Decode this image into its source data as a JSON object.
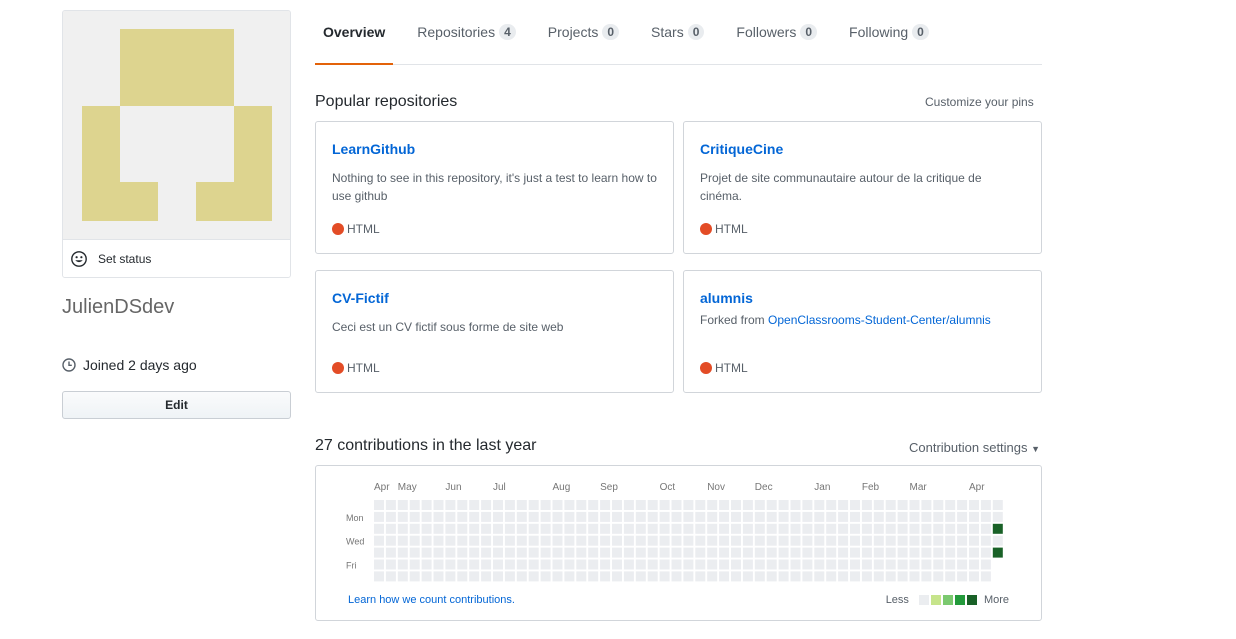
{
  "profile": {
    "username": "JulienDSdev",
    "set_status_label": "Set status",
    "joined": "Joined 2 days ago",
    "edit_label": "Edit",
    "avatar_color": "#ddd48f"
  },
  "tabs": [
    {
      "label": "Overview",
      "count": null,
      "active": true
    },
    {
      "label": "Repositories",
      "count": "4",
      "active": false
    },
    {
      "label": "Projects",
      "count": "0",
      "active": false
    },
    {
      "label": "Stars",
      "count": "0",
      "active": false
    },
    {
      "label": "Followers",
      "count": "0",
      "active": false
    },
    {
      "label": "Following",
      "count": "0",
      "active": false
    }
  ],
  "popular": {
    "title": "Popular repositories",
    "customize_label": "Customize your pins",
    "repos": [
      {
        "name": "LearnGithub",
        "description": "Nothing to see in this repository, it's just a test to learn how to use github",
        "language": "HTML"
      },
      {
        "name": "CritiqueCine",
        "description": "Projet de site communautaire autour de la critique de cinéma.",
        "language": "HTML"
      },
      {
        "name": "CV-Fictif",
        "description": "Ceci est un CV fictif sous forme de site web",
        "language": "HTML"
      },
      {
        "name": "alumnis",
        "forked_prefix": "Forked from ",
        "forked_from": "OpenClassrooms-Student-Center/alumnis",
        "language": "HTML"
      }
    ],
    "language_color": "#e34c26"
  },
  "contributions": {
    "title": "27 contributions in the last year",
    "settings_label": "Contribution settings",
    "months": [
      "Apr",
      "May",
      "Jun",
      "Jul",
      "Aug",
      "Sep",
      "Oct",
      "Nov",
      "Dec",
      "Jan",
      "Feb",
      "Mar",
      "Apr"
    ],
    "days": [
      "Mon",
      "Wed",
      "Fri"
    ],
    "active_cells": [
      {
        "week": 52,
        "day": 2,
        "level": 4
      },
      {
        "week": 52,
        "day": 4,
        "level": 4
      }
    ],
    "learn_label": "Learn how we count contributions.",
    "legend_less": "Less",
    "legend_more": "More",
    "level_colors": [
      "#ebedf0",
      "#c6e48b",
      "#7bc96f",
      "#239a3b",
      "#196127"
    ]
  }
}
